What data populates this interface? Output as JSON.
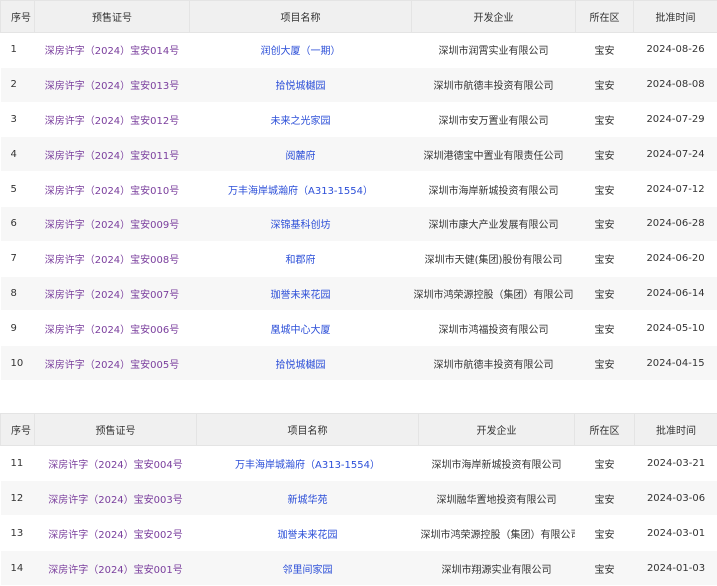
{
  "headers": {
    "no": "序号",
    "license": "预售证号",
    "project": "项目名称",
    "developer": "开发企业",
    "district": "所在区",
    "date": "批准时间"
  },
  "colors": {
    "license_link": "#7a3e9d",
    "project_link": "#2c4fd8",
    "header_bg": "#f0f0f0",
    "row_alt_bg": "#f7f7f7"
  },
  "table1": {
    "rows": [
      {
        "no": "1",
        "license": "深房许字（2024）宝安014号",
        "project": "润创大厦（一期）",
        "developer": "深圳市润霄实业有限公司",
        "district": "宝安",
        "date": "2024-08-26"
      },
      {
        "no": "2",
        "license": "深房许字（2024）宝安013号",
        "project": "拾悦城樾园",
        "developer": "深圳市航德丰投资有限公司",
        "district": "宝安",
        "date": "2024-08-08"
      },
      {
        "no": "3",
        "license": "深房许字（2024）宝安012号",
        "project": "未来之光家园",
        "developer": "深圳市安万置业有限公司",
        "district": "宝安",
        "date": "2024-07-29"
      },
      {
        "no": "4",
        "license": "深房许字（2024）宝安011号",
        "project": "阅麓府",
        "developer": "深圳港德宝中置业有限责任公司",
        "district": "宝安",
        "date": "2024-07-24"
      },
      {
        "no": "5",
        "license": "深房许字（2024）宝安010号",
        "project": "万丰海岸城瀚府（A313-1554）",
        "developer": "深圳市海岸新城投资有限公司",
        "district": "宝安",
        "date": "2024-07-12"
      },
      {
        "no": "6",
        "license": "深房许字（2024）宝安009号",
        "project": "深锦基科创坊",
        "developer": "深圳市康大产业发展有限公司",
        "district": "宝安",
        "date": "2024-06-28"
      },
      {
        "no": "7",
        "license": "深房许字（2024）宝安008号",
        "project": "和郡府",
        "developer": "深圳市天健(集团)股份有限公司",
        "district": "宝安",
        "date": "2024-06-20"
      },
      {
        "no": "8",
        "license": "深房许字（2024）宝安007号",
        "project": "珈誉未来花园",
        "developer": "深圳市鸿荣源控股（集团）有限公司",
        "district": "宝安",
        "date": "2024-06-14"
      },
      {
        "no": "9",
        "license": "深房许字（2024）宝安006号",
        "project": "凰城中心大厦",
        "developer": "深圳市鸿福投资有限公司",
        "district": "宝安",
        "date": "2024-05-10"
      },
      {
        "no": "10",
        "license": "深房许字（2024）宝安005号",
        "project": "拾悦城樾园",
        "developer": "深圳市航德丰投资有限公司",
        "district": "宝安",
        "date": "2024-04-15"
      }
    ]
  },
  "table2": {
    "rows": [
      {
        "no": "11",
        "license": "深房许字（2024）宝安004号",
        "project": "万丰海岸城瀚府（A313-1554）",
        "developer": "深圳市海岸新城投资有限公司",
        "district": "宝安",
        "date": "2024-03-21"
      },
      {
        "no": "12",
        "license": "深房许字（2024）宝安003号",
        "project": "新城华苑",
        "developer": "深圳融华置地投资有限公司",
        "district": "宝安",
        "date": "2024-03-06"
      },
      {
        "no": "13",
        "license": "深房许字（2024）宝安002号",
        "project": "珈誉未来花园",
        "developer": "深圳市鸿荣源控股（集团）有限公司",
        "district": "宝安",
        "date": "2024-03-01"
      },
      {
        "no": "14",
        "license": "深房许字（2024）宝安001号",
        "project": "邻里间家园",
        "developer": "深圳市翔源实业有限公司",
        "district": "宝安",
        "date": "2024-01-03"
      }
    ]
  }
}
